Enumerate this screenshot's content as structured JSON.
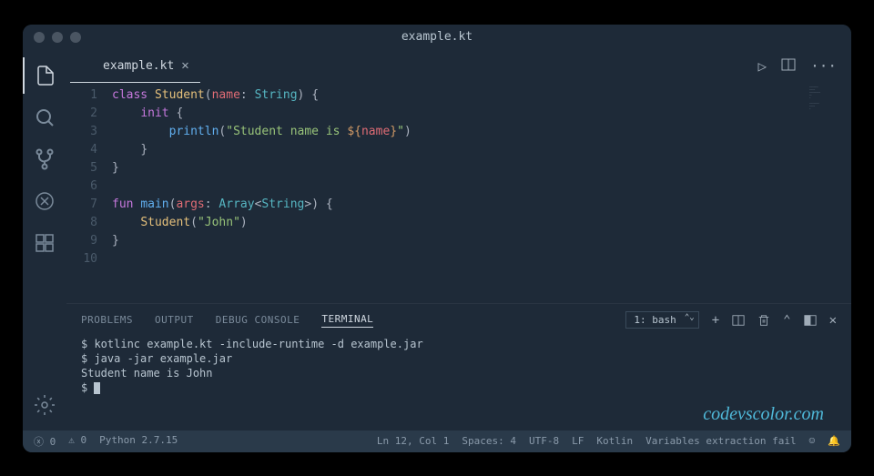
{
  "title": "example.kt",
  "tab": {
    "label": "example.kt"
  },
  "code": {
    "lines": [
      "1",
      "2",
      "3",
      "4",
      "5",
      "6",
      "7",
      "8",
      "9",
      "10"
    ],
    "class_kw": "class",
    "class_name": "Student",
    "paren_open": "(",
    "param_name": "name",
    "colon": ":",
    "param_type": "String",
    "paren_close": ")",
    "brace_open": "{",
    "init_kw": "init",
    "println": "println",
    "str_open": "\"Student name is ",
    "interp_open": "${",
    "interp_var": "name",
    "interp_close": "}",
    "str_close": "\"",
    "brace_close": "}",
    "fun_kw": "fun",
    "main_name": "main",
    "args_name": "args",
    "array_type": "Array",
    "lt": "<",
    "string_type": "String",
    "gt": ">",
    "student_call": "Student",
    "john_str": "\"John\""
  },
  "panel": {
    "tabs": {
      "problems": "PROBLEMS",
      "output": "OUTPUT",
      "debugconsole": "DEBUG CONSOLE",
      "terminal": "TERMINAL"
    },
    "term_label": "1: bash"
  },
  "terminal": {
    "l1": "$ kotlinc example.kt -include-runtime -d example.jar",
    "l2": "$ java -jar example.jar",
    "l3": "Student name is John",
    "l4": "$ "
  },
  "status": {
    "errors": "0",
    "warnings": "0",
    "python": "Python 2.7.15",
    "lncol": "Ln 12, Col 1",
    "spaces": "Spaces: 4",
    "encoding": "UTF-8",
    "eol": "LF",
    "lang": "Kotlin",
    "git": "Variables extraction fail"
  },
  "watermark": "codevscolor.com"
}
